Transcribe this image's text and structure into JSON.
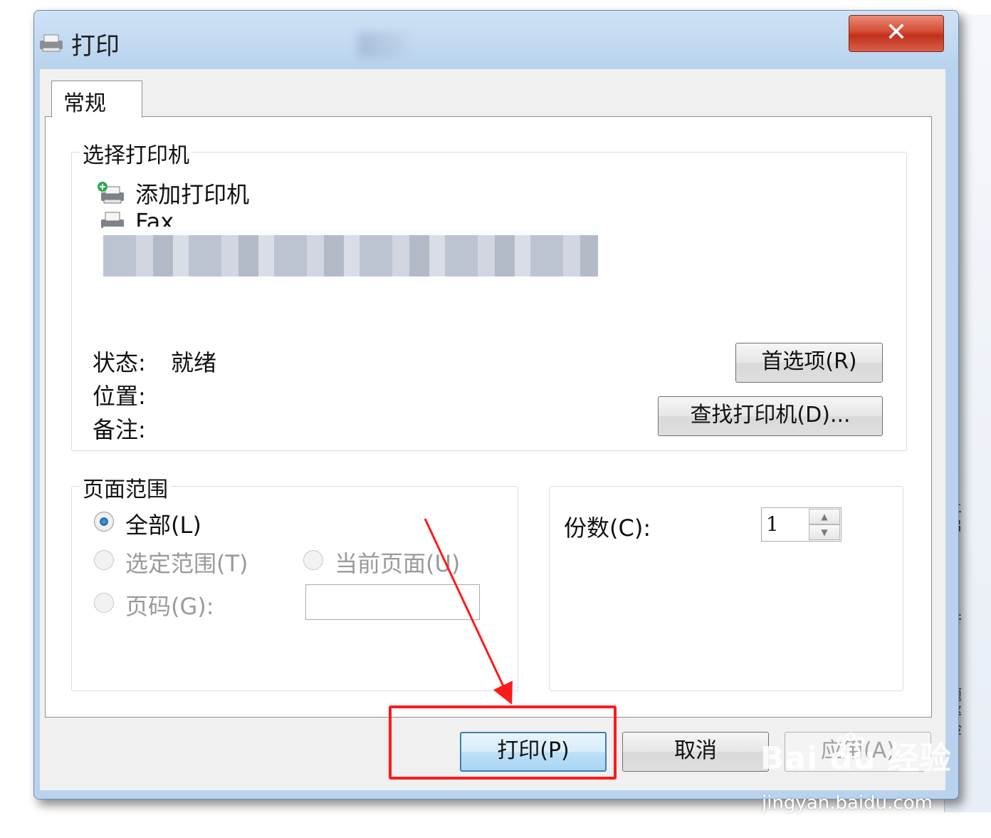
{
  "window": {
    "title": "打印"
  },
  "tabs": [
    {
      "label": "常规",
      "active": true
    }
  ],
  "printer_group": {
    "label": "选择打印机",
    "printers": [
      {
        "name": "添加打印机",
        "icon": "add-printer-icon"
      },
      {
        "name": "Fax",
        "icon": "fax-printer-icon"
      }
    ],
    "status_label": "状态:",
    "status_value": "就绪",
    "location_label": "位置:",
    "comment_label": "备注:",
    "preferences_button": "首选项(R)",
    "find_printer_button": "查找打印机(D)..."
  },
  "page_range": {
    "label": "页面范围",
    "options": {
      "all": "全部(L)",
      "selection": "选定范围(T)",
      "current_page": "当前页面(U)",
      "pages": "页码(G):"
    },
    "selected": "all"
  },
  "copies": {
    "label": "份数(C):",
    "value": "1"
  },
  "buttons": {
    "print": "打印(P)",
    "cancel": "取消",
    "apply": "应用(A)"
  },
  "background_window_text": [
    "上",
    "启",
    "»",
    "行",
    "题",
    "率",
    "检"
  ],
  "watermark": {
    "logo": "Bai du 经验",
    "url": "jingyan.baidu.com"
  },
  "colors": {
    "highlight_box": "#ff1a1a",
    "close_button": "#c1301c",
    "default_button_border": "#3c7fb1"
  }
}
